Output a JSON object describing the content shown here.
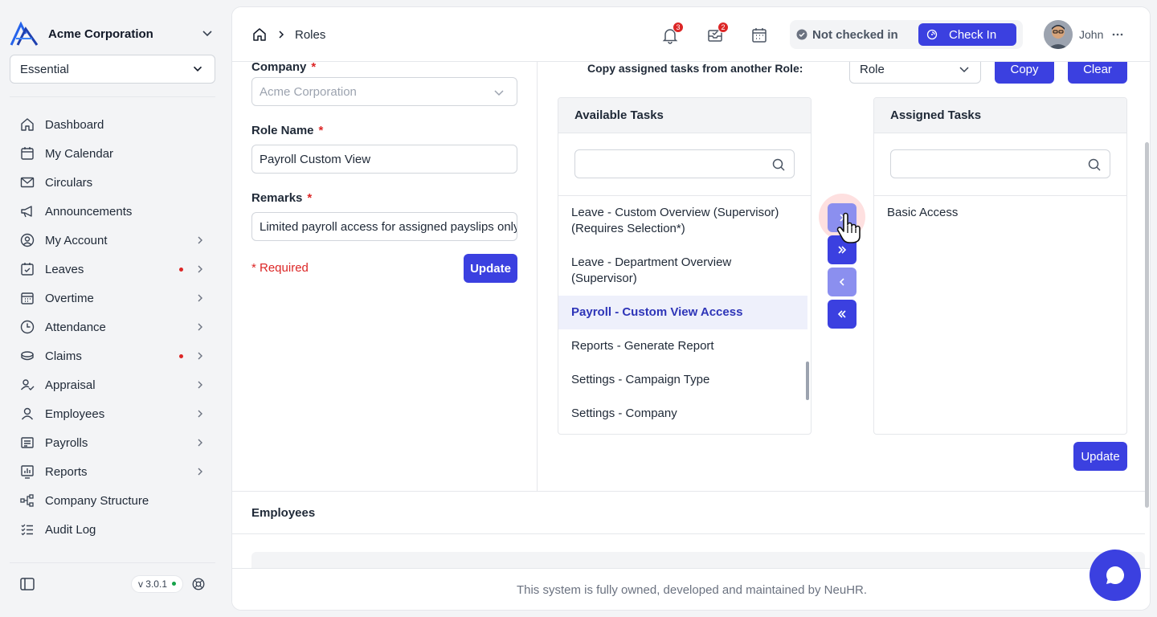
{
  "sidebar": {
    "company_name": "Acme Corporation",
    "plan": "Essential",
    "items": [
      {
        "label": "Dashboard",
        "icon": "home-icon",
        "has_children": false,
        "dot": false
      },
      {
        "label": "My Calendar",
        "icon": "calendar-icon",
        "has_children": false,
        "dot": false
      },
      {
        "label": "Circulars",
        "icon": "mail-icon",
        "has_children": false,
        "dot": false
      },
      {
        "label": "Announcements",
        "icon": "megaphone-icon",
        "has_children": false,
        "dot": false
      },
      {
        "label": "My Account",
        "icon": "user-circle-icon",
        "has_children": true,
        "dot": false
      },
      {
        "label": "Leaves",
        "icon": "calendar-check-icon",
        "has_children": true,
        "dot": true
      },
      {
        "label": "Overtime",
        "icon": "calendar-grid-icon",
        "has_children": true,
        "dot": false
      },
      {
        "label": "Attendance",
        "icon": "clock-icon",
        "has_children": true,
        "dot": false
      },
      {
        "label": "Claims",
        "icon": "coins-icon",
        "has_children": true,
        "dot": true
      },
      {
        "label": "Appraisal",
        "icon": "user-check-icon",
        "has_children": true,
        "dot": false
      },
      {
        "label": "Employees",
        "icon": "user-icon",
        "has_children": true,
        "dot": false
      },
      {
        "label": "Payrolls",
        "icon": "receipt-icon",
        "has_children": true,
        "dot": false
      },
      {
        "label": "Reports",
        "icon": "report-chart-icon",
        "has_children": true,
        "dot": false
      },
      {
        "label": "Company Structure",
        "icon": "org-chart-icon",
        "has_children": false,
        "dot": false
      },
      {
        "label": "Audit Log",
        "icon": "checklist-icon",
        "has_children": false,
        "dot": false
      }
    ],
    "version": "v 3.0.1"
  },
  "topbar": {
    "breadcrumb_current": "Roles",
    "notifications_count": "3",
    "inbox_count": "2",
    "checkin_status": "Not checked in",
    "checkin_button": "Check In",
    "user_name": "John"
  },
  "form": {
    "company_label": "Company",
    "company_value": "Acme Corporation",
    "role_name_label": "Role Name",
    "role_name_value": "Payroll Custom View",
    "remarks_label": "Remarks",
    "remarks_value": "Limited payroll access for assigned payslips only",
    "required_mark": "*",
    "required_note": "* Required",
    "update_label": "Update"
  },
  "tasks": {
    "copy_label": "Copy assigned tasks from another Role:",
    "role_select_placeholder": "Role",
    "copy_button": "Copy",
    "clear_button": "Clear",
    "available_title": "Available Tasks",
    "assigned_title": "Assigned Tasks",
    "available": [
      {
        "label": "Leave - Custom Overview (Supervisor) (Requires Selection*)",
        "selected": false
      },
      {
        "label": "Leave - Department Overview (Supervisor)",
        "selected": false
      },
      {
        "label": "Payroll - Custom View Access",
        "selected": true
      },
      {
        "label": "Reports - Generate Report",
        "selected": false
      },
      {
        "label": "Settings - Campaign Type",
        "selected": false
      },
      {
        "label": "Settings - Company",
        "selected": false
      }
    ],
    "assigned": [
      {
        "label": "Basic Access"
      }
    ],
    "update_label": "Update"
  },
  "employees": {
    "title": "Employees"
  },
  "footer": {
    "text": "This system is fully owned, developed and maintained by NeuHR."
  },
  "colors": {
    "primary": "#3b40e0",
    "primary_light": "#8b8fef",
    "danger": "#dc2626",
    "success": "#16a34a"
  }
}
